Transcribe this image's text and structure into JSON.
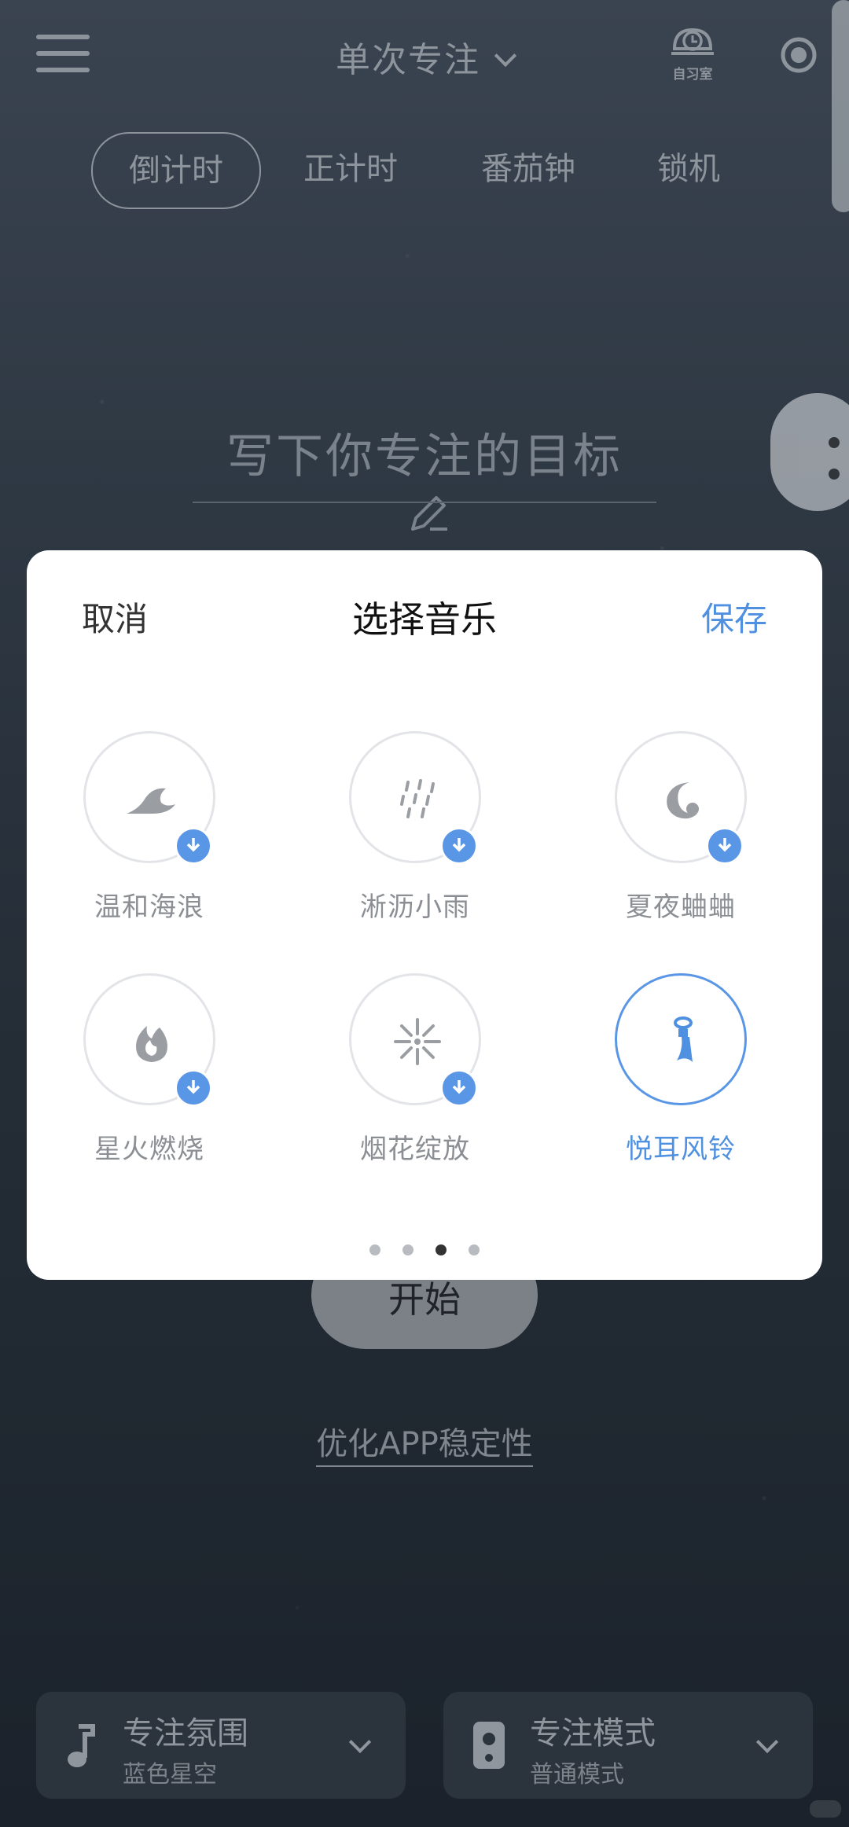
{
  "header": {
    "title": "单次专注",
    "study_room_label": "自习室"
  },
  "tabs": [
    {
      "label": "倒计时",
      "active": true
    },
    {
      "label": "正计时",
      "active": false
    },
    {
      "label": "番茄钟",
      "active": false
    },
    {
      "label": "锁机",
      "active": false
    }
  ],
  "goal": {
    "placeholder": "写下你专注的目标"
  },
  "start_button": "开始",
  "optimize_link": "优化APP稳定性",
  "bottom": {
    "atmosphere": {
      "title": "专注氛围",
      "value": "蓝色星空"
    },
    "mode": {
      "title": "专注模式",
      "value": "普通模式"
    }
  },
  "modal": {
    "cancel": "取消",
    "title": "选择音乐",
    "save": "保存",
    "items": [
      {
        "label": "温和海浪",
        "icon": "wave-icon",
        "downloadable": true,
        "selected": false
      },
      {
        "label": "淅沥小雨",
        "icon": "rain-icon",
        "downloadable": true,
        "selected": false
      },
      {
        "label": "夏夜蛐蛐",
        "icon": "moon-night-icon",
        "downloadable": true,
        "selected": false
      },
      {
        "label": "星火燃烧",
        "icon": "flame-icon",
        "downloadable": true,
        "selected": false
      },
      {
        "label": "烟花绽放",
        "icon": "firework-icon",
        "downloadable": true,
        "selected": false
      },
      {
        "label": "悦耳风铃",
        "icon": "wind-chime-icon",
        "downloadable": false,
        "selected": true
      }
    ],
    "pagination": {
      "pages": 4,
      "current": 3
    }
  },
  "colors": {
    "accent": "#4f90e0",
    "badge": "#5a96e6"
  }
}
